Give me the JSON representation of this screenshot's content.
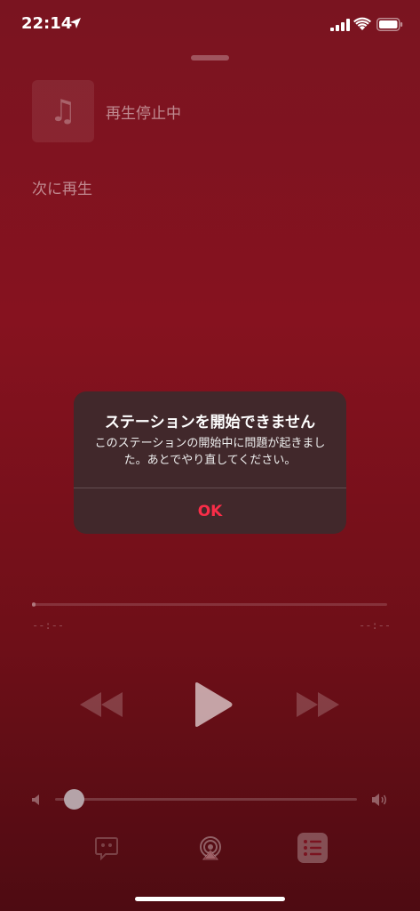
{
  "status_bar": {
    "time": "22:14",
    "icons": [
      "location-arrow-icon",
      "cellular-signal-icon",
      "wifi-icon",
      "battery-icon"
    ]
  },
  "now_playing": {
    "track_title": "再生停止中",
    "artwork_icon": "music-note-icon"
  },
  "up_next": {
    "label": "次に再生"
  },
  "scrubber": {
    "elapsed": "--:--",
    "remaining": "--:--",
    "progress": 0
  },
  "controls": {
    "icons": [
      "rewind-icon",
      "play-icon",
      "fast-forward-icon"
    ]
  },
  "volume": {
    "level": 0.03,
    "icons": [
      "volume-min-icon",
      "volume-max-icon"
    ]
  },
  "bottom_bar": {
    "icons": [
      "lyrics-icon",
      "airplay-icon",
      "queue-icon"
    ]
  },
  "alert": {
    "title": "ステーションを開始できません",
    "message": "このステーションの開始中に問題が起きました。あとでやり直してください。",
    "ok_label": "OK"
  },
  "colors": {
    "background": "#86121f",
    "alert_background": "#3e2a2c",
    "accent": "#fa2d48"
  }
}
